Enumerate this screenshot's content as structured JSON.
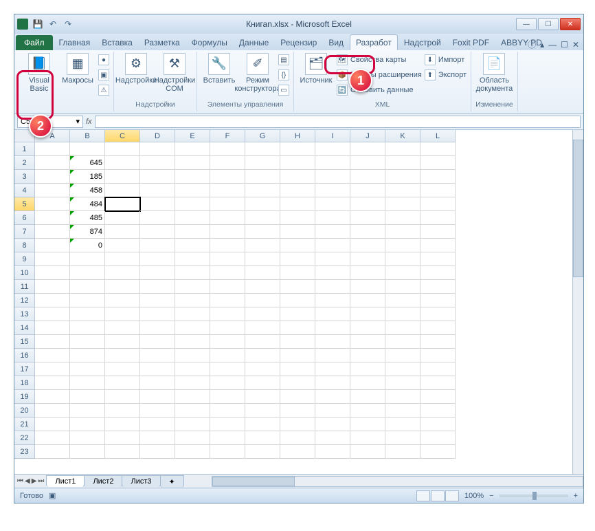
{
  "window": {
    "title": "Книгаn.xlsx - Microsoft Excel",
    "qat_save": "💾",
    "qat_undo": "↶",
    "qat_redo": "↷",
    "btn_min": "—",
    "btn_max": "☐",
    "btn_close": "✕"
  },
  "tabs": {
    "file": "Файл",
    "items": [
      "Главная",
      "Вставка",
      "Разметка",
      "Формулы",
      "Данные",
      "Рецензир",
      "Вид",
      "Разработ",
      "Надстрой",
      "Foxit PDF",
      "ABBYY PD"
    ],
    "active_index": 7
  },
  "ribbon": {
    "g1": {
      "vb": "Visual Basic",
      "macros": "Макросы",
      "label": ""
    },
    "g2": {
      "addins": "Надстройки",
      "com": "Надстройки COM",
      "label": "Надстройки"
    },
    "g3": {
      "insert": "Вставить",
      "design": "Режим конструктора",
      "label": "Элементы управления"
    },
    "g4": {
      "source": "Источник",
      "mapprops": "Свойства карты",
      "packs": "Пакеты расширения",
      "refresh": "Обновить данные",
      "import": "Импорт",
      "export": "Экспорт",
      "label": "XML"
    },
    "g5": {
      "docpanel": "Область документа",
      "label": "Изменение"
    }
  },
  "namebox": "C5",
  "fx": "fx",
  "columns": [
    "A",
    "B",
    "C",
    "D",
    "E",
    "F",
    "G",
    "H",
    "I",
    "J",
    "K",
    "L"
  ],
  "rows": [
    1,
    2,
    3,
    4,
    5,
    6,
    7,
    8,
    9,
    10,
    11,
    12,
    13,
    14,
    15,
    16,
    17,
    18,
    19,
    20,
    21,
    22,
    23
  ],
  "cell_data": {
    "B2": "645",
    "B3": "185",
    "B4": "458",
    "B5": "484",
    "B6": "485",
    "B7": "874",
    "B8": "0"
  },
  "selected_cell": "C5",
  "selected_row": 5,
  "selected_col": "C",
  "sheets": [
    "Лист1",
    "Лист2",
    "Лист3"
  ],
  "active_sheet": 0,
  "status": "Готово",
  "zoom": "100%",
  "callouts": {
    "c1": "1",
    "c2": "2"
  }
}
